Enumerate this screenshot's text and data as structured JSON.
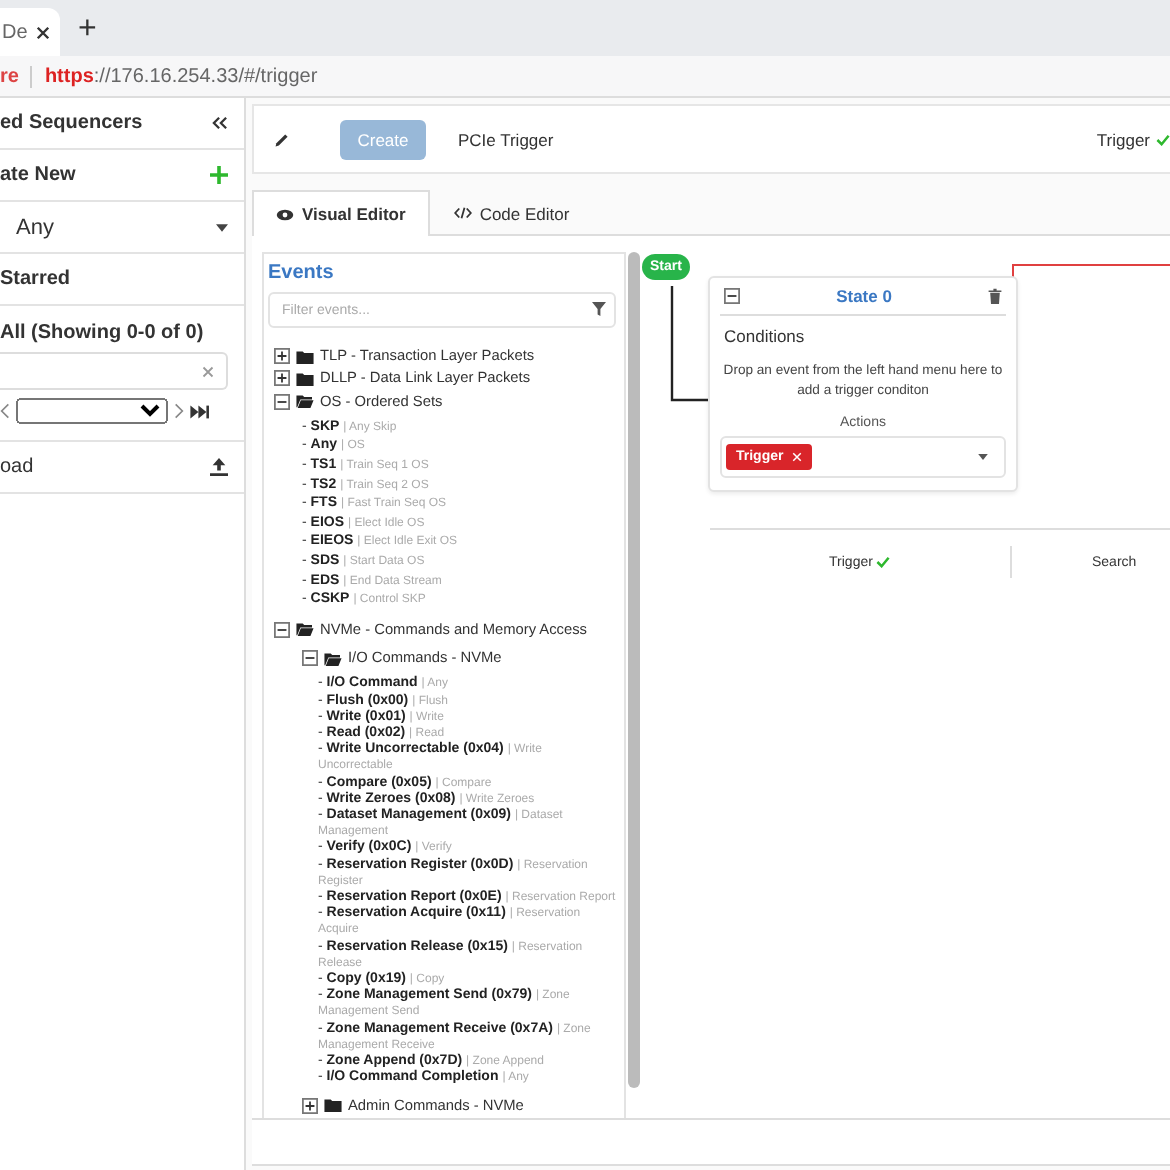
{
  "browser": {
    "tab_title": "De",
    "new_tab": "+",
    "security": "re",
    "url_scheme": "https",
    "url_rest": "://176.16.254.33/#/trigger"
  },
  "sidebar": {
    "header": "ed Sequencers",
    "create_new": "ate New",
    "filter_value": "Any",
    "starred": "Starred",
    "all_label": "All (Showing 0-0 of 0)",
    "upload": "oad"
  },
  "toolbar": {
    "create_button": {
      "label": "Create",
      "disabled": true
    },
    "trigger_name": "PCIe Trigger",
    "status": "Trigger"
  },
  "tabs": [
    {
      "label": "Visual Editor",
      "selected": true
    },
    {
      "label": "Code Editor",
      "selected": false
    }
  ],
  "events": {
    "title": "Events",
    "filter_placeholder": "Filter events...",
    "tree": [
      {
        "kind": "group",
        "label": "TLP - Transaction Layer Packets",
        "expanded": false
      },
      {
        "kind": "group",
        "label": "DLLP - Data Link Layer Packets",
        "expanded": false
      },
      {
        "kind": "group",
        "label": "OS - Ordered Sets",
        "expanded": true,
        "children": [
          {
            "kind": "event",
            "name": "- **SKP**",
            "desc": "| Any Skip"
          },
          {
            "kind": "event",
            "name": "- **Any**",
            "desc": "| OS"
          },
          {
            "kind": "event",
            "name": "- **TS1**",
            "desc": "| Train Seq 1 OS"
          },
          {
            "kind": "event",
            "name": "- **TS2**",
            "desc": "| Train Seq 2 OS"
          },
          {
            "kind": "event",
            "name": "- **FTS**",
            "desc": "| Fast Train Seq OS"
          },
          {
            "kind": "event",
            "name": "- **EIOS**",
            "desc": "| Elect Idle OS"
          },
          {
            "kind": "event",
            "name": "- **EIEOS**",
            "desc": "| Elect Idle Exit OS"
          },
          {
            "kind": "event",
            "name": "- **SDS**",
            "desc": "| Start Data OS"
          },
          {
            "kind": "event",
            "name": "- **EDS**",
            "desc": "| End Data Stream"
          },
          {
            "kind": "event",
            "name": "- **CSKP**",
            "desc": "| Control SKP"
          }
        ]
      },
      {
        "kind": "group",
        "label": "NVMe - Commands and Memory Access",
        "expanded": true,
        "children": [
          {
            "kind": "group",
            "label": "I/O Commands - NVMe",
            "expanded": true,
            "children": [
              {
                "kind": "event",
                "name": "- **I/O Command**",
                "desc": "| Any"
              },
              {
                "kind": "event",
                "name": "- **Flush (0x00)**",
                "desc": "| Flush"
              },
              {
                "kind": "event",
                "name": "- **Write (0x01)**",
                "desc": "| Write"
              },
              {
                "kind": "event",
                "name": "- **Read (0x02)**",
                "desc": "| Read"
              },
              {
                "kind": "event",
                "name": "- **Write Uncorrectable (0x04)**",
                "desc": "| Write Uncorrectable"
              },
              {
                "kind": "event",
                "name": "- **Compare (0x05)**",
                "desc": "| Compare"
              },
              {
                "kind": "event",
                "name": "- **Write Zeroes (0x08)**",
                "desc": "| Write Zeroes"
              },
              {
                "kind": "event",
                "name": "- **Dataset Management (0x09)**",
                "desc": "| Dataset Management"
              },
              {
                "kind": "event",
                "name": "- **Verify (0x0C)**",
                "desc": "| Verify"
              },
              {
                "kind": "event",
                "name": "- **Reservation Register (0x0D)**",
                "desc": "| Reservation Register"
              },
              {
                "kind": "event",
                "name": "- **Reservation Report (0x0E)**",
                "desc": "| Reservation Report"
              },
              {
                "kind": "event",
                "name": "- **Reservation Acquire (0x11)**",
                "desc": "| Reservation Acquire"
              },
              {
                "kind": "event",
                "name": "- **Reservation Release (0x15)**",
                "desc": "| Reservation Release"
              },
              {
                "kind": "event",
                "name": "- **Copy (0x19)**",
                "desc": "| Copy"
              },
              {
                "kind": "event",
                "name": "- **Zone Management Send (0x79)**",
                "desc": "| Zone Management Send"
              },
              {
                "kind": "event",
                "name": "- **Zone Management Receive (0x7A)**",
                "desc": "| Zone Management Receive"
              },
              {
                "kind": "event",
                "name": "- **Zone Append (0x7D)**",
                "desc": "| Zone Append"
              },
              {
                "kind": "event",
                "name": "- **I/O Command Completion**",
                "desc": "| Any"
              }
            ]
          },
          {
            "kind": "group",
            "label": "Admin Commands - NVMe",
            "expanded": false
          }
        ]
      }
    ]
  },
  "canvas": {
    "start": "Start",
    "state": {
      "title": "State 0",
      "conditions": "Conditions",
      "hint": "Drop an event from the left hand menu here to add a trigger conditon",
      "actions": "Actions",
      "action_tag": "Trigger"
    },
    "footer": [
      {
        "label": "Trigger",
        "ok": true
      },
      {
        "label": "Search",
        "ok": false
      }
    ]
  }
}
